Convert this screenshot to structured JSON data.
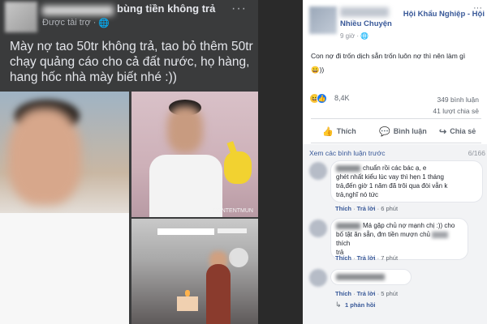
{
  "left_post": {
    "page_name": "bùng tiền không trả",
    "sponsored_label": "Được tài trợ ·",
    "globe_icon": "globe-icon",
    "more_label": "···",
    "body_lines": [
      "Mày nợ tao 50tr không trả, tao bỏ thêm 50tr",
      "chạy quảng cáo cho cả đất nước, họ hàng,",
      "hang hốc nhà mày biết nhé :))"
    ],
    "watermark": "CONTENTMUN"
  },
  "right_post": {
    "group_name_line1": "Hội Khẩu Nghiệp - Hội",
    "group_name_line2": "Nhiều Chuyện",
    "time_label": "9 giờ ·",
    "more_label": "···",
    "body": "Con nợ đi trốn dịch sẵn trốn luôn nợ thì nên làm gì",
    "body_emoji": "😀))",
    "reactions_count": "8,4K",
    "comments_count": "349 bình luận",
    "shares_count": "41 lượt chia sẻ",
    "actions": {
      "like": "Thích",
      "comment": "Bình luận",
      "share": "Chia sẻ"
    },
    "view_previous": "Xem các bình luận trước",
    "comment_page": "6/166",
    "comments": [
      {
        "text_line1": "chuẩn rồi các bác ạ, e",
        "text_line2": "ghét nhất kiểu lúc vay thì hẹn 1 tháng",
        "text_line3": "trả,đến giờ 1 năm đã trôi qua đòi vẫn k",
        "text_line4": "trả,nghĩ nó tức",
        "like_label": "Thích",
        "reply_label": "Trả lời",
        "time": "6 phút"
      },
      {
        "text_line1": "Má gặp chủ nợ mạnh chị :)) cho",
        "text_line2": "bố tật ăn sẵn, đm tiền mượn chủ",
        "text_line2_end": "thích",
        "text_line3": "trả",
        "like_label": "Thích",
        "reply_label": "Trả lời",
        "time": "7 phút"
      },
      {
        "like_label": "Thích",
        "reply_label": "Trả lời",
        "time": "5 phút"
      }
    ],
    "replies_label": "1 phản hồi"
  },
  "icons": {
    "thumbs_up": "👍",
    "comment": "💬",
    "share": "↪",
    "haha": "😆",
    "like_react": "👍",
    "reply_arrow": "↳"
  }
}
